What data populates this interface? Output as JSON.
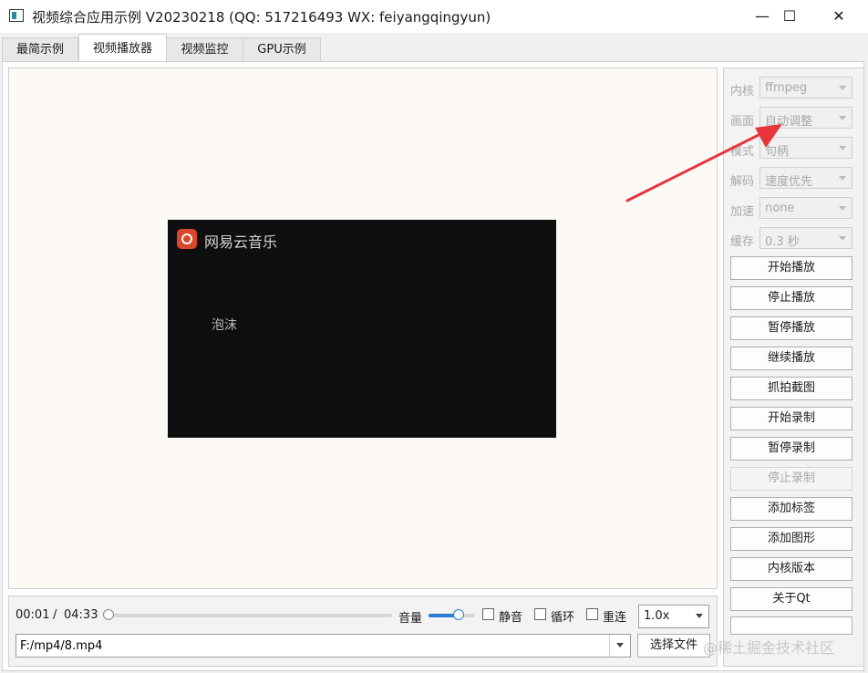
{
  "window": {
    "title": "视频综合应用示例 V20230218 (QQ: 517216493 WX: feiyangqingyun)",
    "minimize_glyph": "—",
    "maximize_glyph": "☐",
    "close_glyph": "✕"
  },
  "tabs": [
    {
      "label": "最简示例",
      "active": false
    },
    {
      "label": "视频播放器",
      "active": true
    },
    {
      "label": "视频监控",
      "active": false
    },
    {
      "label": "GPU示例",
      "active": false
    }
  ],
  "video": {
    "brand": "网易云音乐",
    "lyric": "泡沫"
  },
  "controls": {
    "time_current": "00:01",
    "time_separator": "/",
    "time_total": "04:33",
    "progress_fraction": 0.004,
    "volume_label": "音量",
    "volume_fraction": 0.65,
    "mute_label": "静音",
    "loop_label": "循环",
    "reconnect_label": "重连",
    "speed_value": "1.0x",
    "file_path": "F:/mp4/8.mp4",
    "choose_file_label": "选择文件"
  },
  "settings": [
    {
      "label": "内核",
      "value": "ffmpeg"
    },
    {
      "label": "画面",
      "value": "自动调整"
    },
    {
      "label": "模式",
      "value": "句柄"
    },
    {
      "label": "解码",
      "value": "速度优先"
    },
    {
      "label": "加速",
      "value": "none"
    },
    {
      "label": "缓存",
      "value": "0.3 秒"
    }
  ],
  "side_buttons": [
    {
      "label": "开始播放",
      "enabled": true
    },
    {
      "label": "停止播放",
      "enabled": true
    },
    {
      "label": "暂停播放",
      "enabled": true
    },
    {
      "label": "继续播放",
      "enabled": true
    },
    {
      "label": "抓拍截图",
      "enabled": true
    },
    {
      "label": "开始录制",
      "enabled": true
    },
    {
      "label": "暂停录制",
      "enabled": true
    },
    {
      "label": "停止录制",
      "enabled": false
    },
    {
      "label": "添加标签",
      "enabled": true
    },
    {
      "label": "添加图形",
      "enabled": true
    },
    {
      "label": "内核版本",
      "enabled": true
    },
    {
      "label": "关于Qt",
      "enabled": true
    }
  ],
  "watermark": "@稀土掘金技术社区",
  "colors": {
    "annotation_arrow": "#e8353a",
    "accent": "#2a7bd6"
  }
}
